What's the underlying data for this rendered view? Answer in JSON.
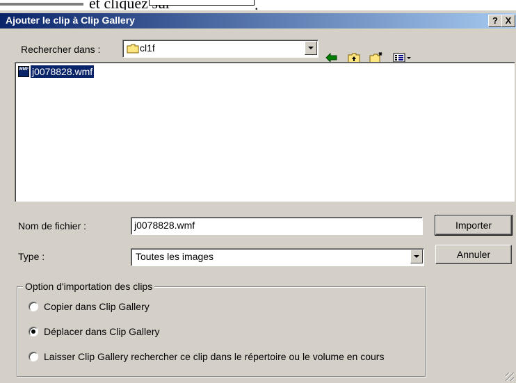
{
  "above": {
    "text": "et cliquez sur",
    "trailing": "."
  },
  "dialog": {
    "title": "Ajouter le clip à Clip Gallery",
    "help_button": "?",
    "close_button": "X"
  },
  "lookin": {
    "label": "Rechercher dans :",
    "folder": "cl1f"
  },
  "toolbar": {
    "back": "back-arrow-icon",
    "up": "up-folder-icon",
    "new": "new-folder-icon",
    "views": "views-menu-icon"
  },
  "files": [
    {
      "name": "j0078828.wmf",
      "icon": "wmf-file-icon",
      "icon_text": "WMF",
      "selected": true
    }
  ],
  "filename": {
    "label": "Nom de fichier :",
    "value": "j0078828.wmf"
  },
  "filetype": {
    "label": "Type :",
    "value": "Toutes les images"
  },
  "buttons": {
    "import": "Importer",
    "cancel": "Annuler"
  },
  "options": {
    "legend": "Option d'importation des clips",
    "items": [
      {
        "label": "Copier dans Clip Gallery",
        "checked": false
      },
      {
        "label": "Déplacer dans Clip Gallery",
        "checked": true
      },
      {
        "label": "Laisser Clip Gallery rechercher ce clip dans le répertoire ou le volume en cours",
        "checked": false
      }
    ]
  },
  "colors": {
    "titlebar_start": "#0a246a",
    "titlebar_end": "#a6caf0",
    "face": "#d4d0c8",
    "selection": "#0a246a"
  }
}
